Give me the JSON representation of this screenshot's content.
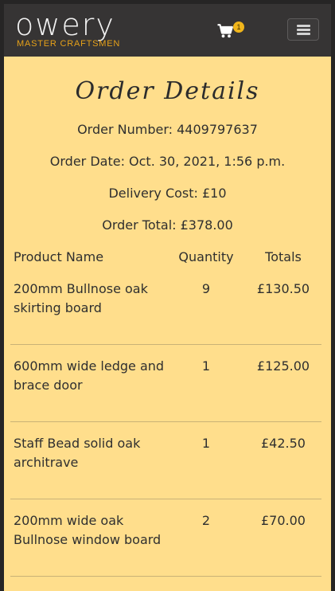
{
  "nav": {
    "brand_word": "owery",
    "brand_sub": "MASTER CRAFTSMEN",
    "cart_count": "1",
    "icons": {
      "cart": "cart-icon",
      "menu": "hamburger-menu-icon"
    },
    "colors": {
      "bar": "#363434",
      "brand_accent": "#e6a119",
      "badge": "#f0b51b"
    }
  },
  "main": {
    "title": "Order Details",
    "order_number": "Order Number: 4409797637",
    "order_date": "Order Date: Oct. 30, 2021, 1:56 p.m.",
    "delivery_cost": "Delivery Cost: £10",
    "order_total": "Order Total: £378.00",
    "background": "#ffde8c"
  },
  "table": {
    "headers": [
      "Product Name",
      "Quantity",
      "Totals"
    ],
    "rows": [
      {
        "name": "200mm Bullnose oak skirting board",
        "quantity": "9",
        "total": "£130.50"
      },
      {
        "name": "600mm wide ledge and brace door",
        "quantity": "1",
        "total": "£125.00"
      },
      {
        "name": "Staff Bead solid oak architrave",
        "quantity": "1",
        "total": "£42.50"
      },
      {
        "name": "200mm wide oak Bullnose window board",
        "quantity": "2",
        "total": "£70.00"
      }
    ]
  }
}
